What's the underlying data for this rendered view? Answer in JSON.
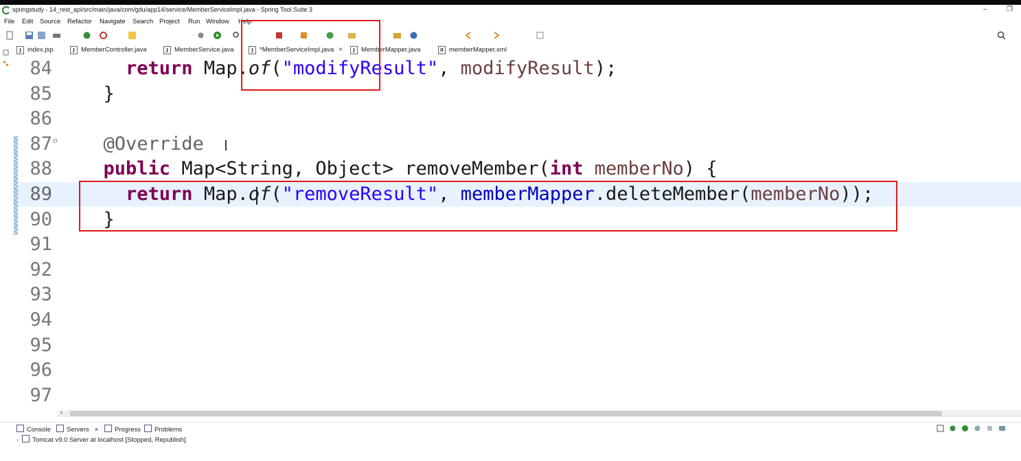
{
  "window": {
    "title": "springstudy - 14_rest_api/src/main/java/com/gdu/app14/service/MemberServiceImpl.java - Spring Tool Suite 3",
    "minimize_glyph": "–",
    "restore_glyph": "❐"
  },
  "menu": [
    "File",
    "Edit",
    "Source",
    "Refactor",
    "Navigate",
    "Search",
    "Project",
    "Run",
    "Window",
    "Help"
  ],
  "tabs": [
    {
      "label": "index.jsp",
      "icon": "jsp-file-icon",
      "letter": "J"
    },
    {
      "label": "MemberController.java",
      "icon": "java-file-icon",
      "letter": "J"
    },
    {
      "label": "MemberService.java",
      "icon": "java-file-icon",
      "letter": "J"
    },
    {
      "label": "*MemberServiceImpl.java",
      "icon": "java-file-icon",
      "letter": "J",
      "active": true,
      "close": "×"
    },
    {
      "label": "MemberMapper.java",
      "icon": "java-file-icon",
      "letter": "J"
    },
    {
      "label": "memberMapper.xml",
      "icon": "xml-file-icon",
      "letter": "X"
    }
  ],
  "editor": {
    "lines": [
      {
        "num": "84",
        "parts": [
          [
            "",
            "    "
          ],
          [
            "kw",
            "return"
          ],
          [
            "",
            " Map."
          ],
          [
            "stat",
            "of"
          ],
          [
            "",
            "("
          ],
          [
            "str",
            "\"modifyResult\""
          ],
          [
            "",
            ", "
          ],
          [
            "var",
            "modifyResult"
          ],
          [
            "",
            ");"
          ]
        ]
      },
      {
        "num": "85",
        "parts": [
          [
            "",
            "  }"
          ]
        ]
      },
      {
        "num": "86",
        "parts": []
      },
      {
        "num": "87",
        "fold": "⊖",
        "parts": [
          [
            "",
            "  "
          ],
          [
            "ann",
            "@Override"
          ]
        ]
      },
      {
        "num": "88",
        "parts": [
          [
            "",
            "  "
          ],
          [
            "kw",
            "public"
          ],
          [
            "",
            " Map<String, Object> removeMember("
          ],
          [
            "kw",
            "int"
          ],
          [
            "",
            " "
          ],
          [
            "var",
            "memberNo"
          ],
          [
            "",
            ") {"
          ]
        ]
      },
      {
        "num": "89",
        "current": true,
        "parts": [
          [
            "",
            "    "
          ],
          [
            "kw",
            "return"
          ],
          [
            "",
            " Map."
          ],
          [
            "stat",
            "of"
          ],
          [
            "",
            "("
          ],
          [
            "str",
            "\"removeResult\""
          ],
          [
            "",
            ", "
          ],
          [
            "field",
            "memberMapper"
          ],
          [
            "",
            ".deleteMember("
          ],
          [
            "var",
            "memberNo"
          ],
          [
            "",
            "));"
          ]
        ]
      },
      {
        "num": "90",
        "parts": [
          [
            "",
            "  }"
          ]
        ]
      },
      {
        "num": "91",
        "parts": []
      },
      {
        "num": "92",
        "parts": []
      },
      {
        "num": "93",
        "parts": []
      },
      {
        "num": "94",
        "parts": []
      },
      {
        "num": "95",
        "parts": []
      },
      {
        "num": "96",
        "parts": []
      },
      {
        "num": "97",
        "parts": []
      }
    ]
  },
  "bottom_panel": {
    "tabs": [
      {
        "label": "Console"
      },
      {
        "label": "Servers",
        "close": "×"
      },
      {
        "label": "Progress"
      },
      {
        "label": "Problems"
      }
    ],
    "server_entry": "Tomcat v9.0 Server at localhost  [Stopped, Republish]",
    "expand_glyph": "›"
  },
  "colors": {
    "keyword": "#7f0055",
    "string": "#2a00ff",
    "field": "#0000c0",
    "annotation_box": "#e01818",
    "current_line": "#e8f2fe"
  }
}
